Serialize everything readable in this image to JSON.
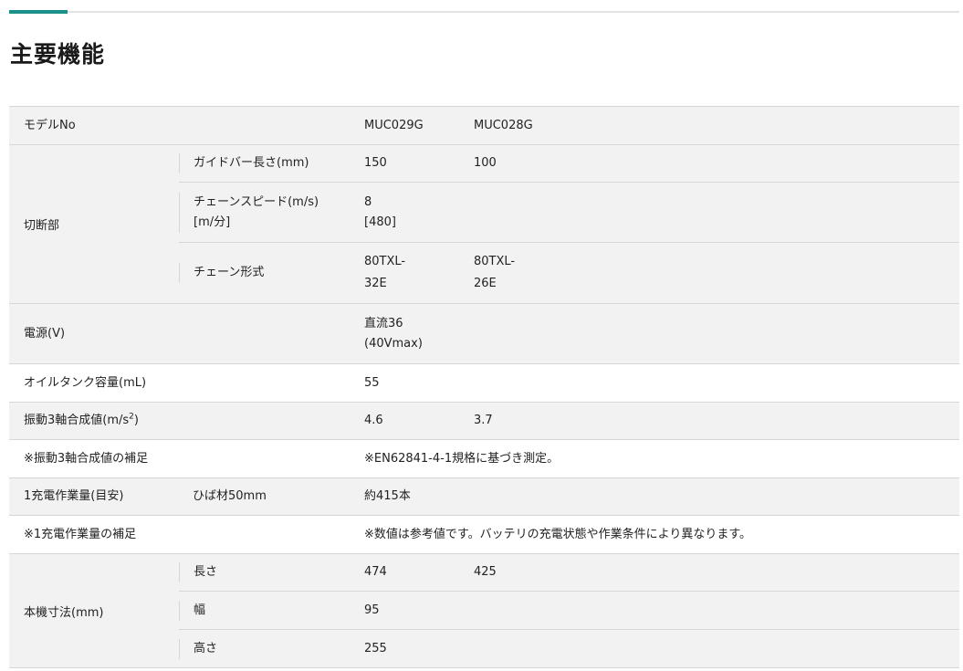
{
  "title": "主要機能",
  "colors": {
    "accent": "#1b8f8a",
    "shade": "#f2f2f2",
    "border": "#d6d6d6"
  },
  "rows": {
    "model": {
      "label": "モデルNo",
      "v1": "MUC029G",
      "v2": "MUC028G"
    },
    "cut": {
      "label": "切断部",
      "guide_bar": {
        "label": "ガイドバー長さ(mm)",
        "v1": "150",
        "v2": "100"
      },
      "chain_speed": {
        "label_1": "チェーンスピード(m/s)",
        "label_2": "[m/分]",
        "v1_1": "8",
        "v1_2": "[480]"
      },
      "chain_type": {
        "label": "チェーン形式",
        "v1_1": "80TXL-",
        "v1_2": "32E",
        "v2_1": "80TXL-",
        "v2_2": "26E"
      }
    },
    "power": {
      "label": "電源(V)",
      "v1_1": "直流36",
      "v1_2": "(40Vmax)"
    },
    "oil": {
      "label": "オイルタンク容量(mL)",
      "v1": "55"
    },
    "vibration": {
      "label_main": "振動3軸合成値(m/s",
      "label_sup": "2",
      "label_end": ")",
      "v1": "4.6",
      "v2": "3.7"
    },
    "vibration_note": {
      "label": "※振動3軸合成値の補足",
      "note": "※EN62841-4-1規格に基づき測定。"
    },
    "work": {
      "label": "1充電作業量(目安)",
      "sub": "ひば材50mm",
      "v1": "約415本"
    },
    "work_note": {
      "label": "※1充電作業量の補足",
      "note": "※数値は参考値です。バッテリの充電状態や作業条件により異なります。"
    },
    "dims": {
      "label": "本機寸法(mm)",
      "length": {
        "label": "長さ",
        "v1": "474",
        "v2": "425"
      },
      "width": {
        "label": "幅",
        "v1": "95"
      },
      "height": {
        "label": "高さ",
        "v1": "255"
      }
    }
  }
}
